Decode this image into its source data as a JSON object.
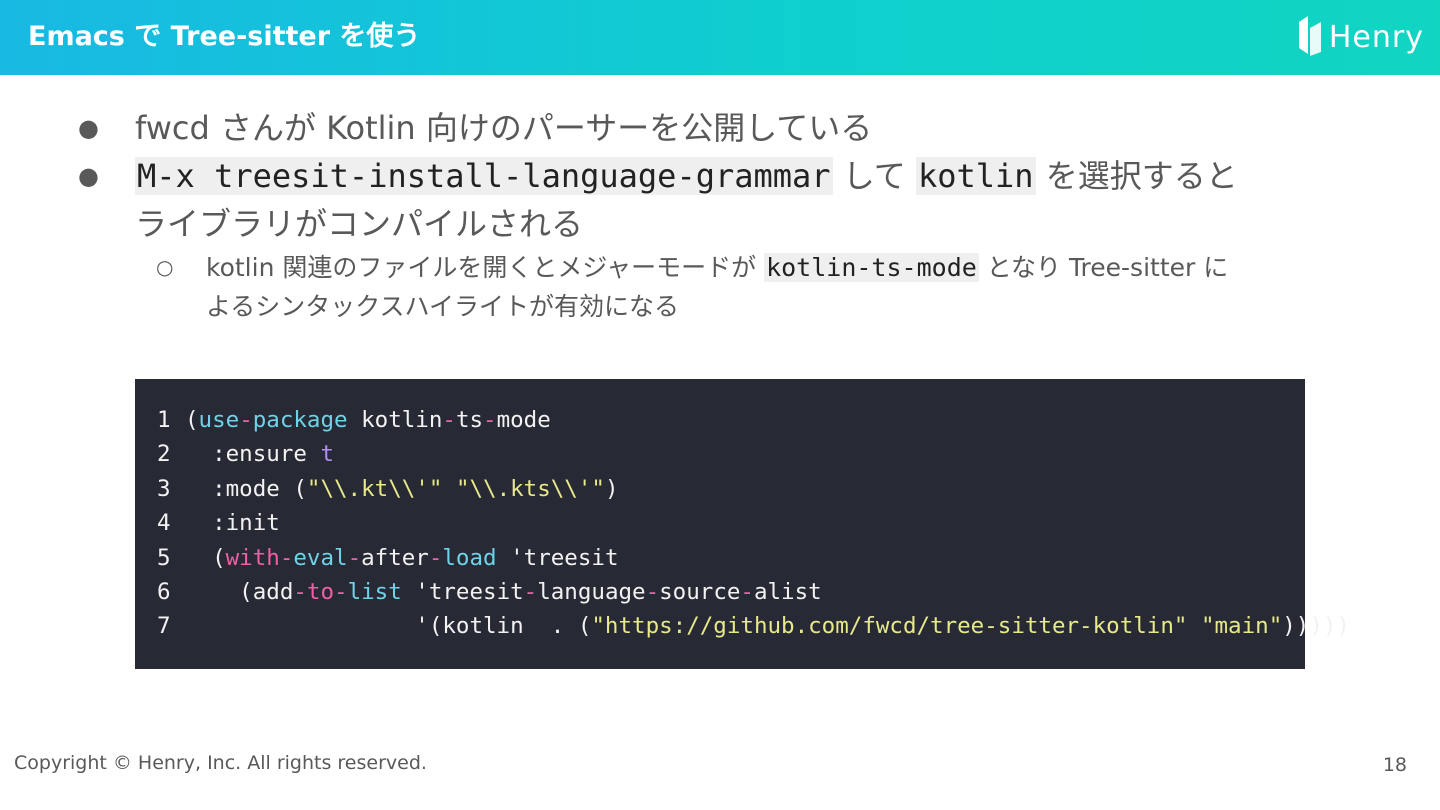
{
  "header": {
    "title": "Emacs で Tree-sitter を使う",
    "logo_text": "Henry"
  },
  "bullets": [
    {
      "part1": "fwcd さんが Kotlin 向けのパーサーを公開している"
    },
    {
      "code1": "M-x treesit-install-language-grammar",
      "part1": " して ",
      "code2": "kotlin",
      "part2": " を選択すると",
      "part3": "ライブラリがコンパイルされる"
    }
  ],
  "sub_bullet": {
    "part1": "kotlin 関連のファイルを開くとメジャーモードが ",
    "code": "kotlin-ts-mode",
    "part2": " となり Tree-sitter に",
    "part3": "よるシンタックスハイライトが有効になる"
  },
  "code_block": {
    "line_numbers": [
      "1",
      "2",
      "3",
      "4",
      "5",
      "6",
      "7"
    ],
    "l1": {
      "open": "(",
      "a": "use",
      "b": "-",
      "c": "package",
      "d": " kotlin",
      "e": "-",
      "f": "ts",
      "g": "-",
      "h": "mode"
    },
    "l2": {
      "a": "  :ensure ",
      "b": "t"
    },
    "l3": {
      "a": "  :mode (",
      "b": "\"\\\\.kt\\\\'\"",
      "c": " ",
      "d": "\"\\\\.kts\\\\'\"",
      "e": ")"
    },
    "l4": {
      "a": "  :init"
    },
    "l5": {
      "a": "  (",
      "b": "with",
      "c": "-",
      "d": "eval",
      "e": "-",
      "f": "after",
      "g": "-",
      "h": "load",
      "i": " 'treesit"
    },
    "l6": {
      "a": "    (add",
      "b": "-",
      "c": "to",
      "d": "-",
      "e": "list",
      "f": " 'treesit",
      "g": "-",
      "h": "language",
      "i": "-",
      "j": "source",
      "k": "-",
      "l": "alist"
    },
    "l7": {
      "a": "                 '(kotlin  . (",
      "b": "\"https://github.com/fwcd/tree-sitter-kotlin\"",
      "c": " ",
      "d": "\"main\"",
      "e": ")))))"
    }
  },
  "footer": {
    "copyright": "Copyright © Henry, Inc. All rights reserved.",
    "page_number": "18"
  },
  "colors": {
    "header_gradient_start": "#18b9e3",
    "header_gradient_end": "#11d4c1",
    "code_bg": "#272a34",
    "code_blue": "#6fd2e8",
    "code_pink": "#ef5fa6",
    "code_purple": "#b38bf5",
    "code_string": "#e7e88a"
  },
  "icons": {
    "logo": "henry-logo-icon",
    "bullet": "filled-circle",
    "sub_bullet": "hollow-circle"
  }
}
